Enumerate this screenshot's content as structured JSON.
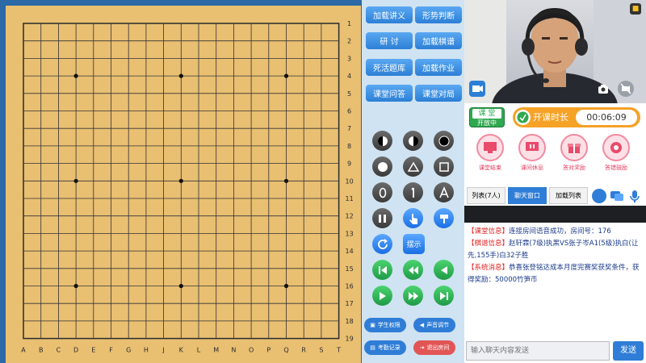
{
  "board": {
    "row_labels": [
      "1",
      "2",
      "3",
      "4",
      "5",
      "6",
      "7",
      "8",
      "9",
      "10",
      "11",
      "12",
      "13",
      "14",
      "15",
      "16",
      "17",
      "18",
      "19"
    ],
    "col_labels": [
      "A",
      "B",
      "C",
      "D",
      "E",
      "F",
      "G",
      "H",
      "J",
      "K",
      "L",
      "M",
      "N",
      "O",
      "P",
      "Q",
      "R",
      "S",
      "T"
    ],
    "star_points": [
      "D4",
      "K4",
      "Q4",
      "D10",
      "K10",
      "Q10",
      "D16",
      "K16",
      "Q16"
    ]
  },
  "tools": {
    "load_lecture": "加载讲义",
    "situation": "形势判断",
    "study": "研 讨",
    "load_record": "加载棋谱",
    "life_death": "死活题库",
    "load_homework": "加载作业",
    "qa": "课堂问答",
    "match": "课堂对局",
    "show": "摆示",
    "student_perm": "学生权限",
    "sound": "声音调节",
    "attendance": "考勤记录",
    "exit_room": "退出房间",
    "icons": [
      "black-white-stone-icon",
      "white-black-stone-icon",
      "black-stone-icon",
      "circle-mark-icon",
      "triangle-mark-icon",
      "square-mark-icon",
      "letter-o-icon",
      "number-one-icon",
      "letter-a-icon",
      "mark-tool-icon",
      "pointer-icon",
      "eraser-icon",
      "refresh-icon",
      "show-icon",
      "first-move-icon",
      "rewind-icon",
      "prev-move-icon",
      "next-move-icon",
      "fast-forward-icon",
      "last-move-icon"
    ]
  },
  "right": {
    "class_badge_top": "课 堂",
    "class_badge_bottom": "开放中",
    "timer_label": "开课时长",
    "timer_value": "00:06:09",
    "actions": [
      "课堂结束",
      "课间休息",
      "答对奖励",
      "答错鼓励"
    ],
    "tabs": [
      "列表(7人)",
      "聊天窗口",
      "加载列表"
    ],
    "chat": [
      {
        "tag": "【课堂信息】",
        "text": "连接房间语音成功，房间号：176"
      },
      {
        "tag": "【棋谱信息】",
        "text": "赵轩霖(7级)执黑VS张子岑A1(5级)执白(让先,155手)白32子胜"
      },
      {
        "tag": "【系统消息】",
        "text": "恭喜张登铭达成本月度完赛奖获奖条件，获得奖励：50000竹笋币"
      }
    ],
    "input_placeholder": "输入聊天内容发送",
    "send_label": "发送"
  },
  "colors": {
    "board": "#e9bf72",
    "tool_button": "#2c7fd6",
    "timer_orange": "#f5a227",
    "timer_green": "#2fa84f",
    "chat_tag_red": "#e02020",
    "chat_text_blue": "#1a3a8a"
  }
}
